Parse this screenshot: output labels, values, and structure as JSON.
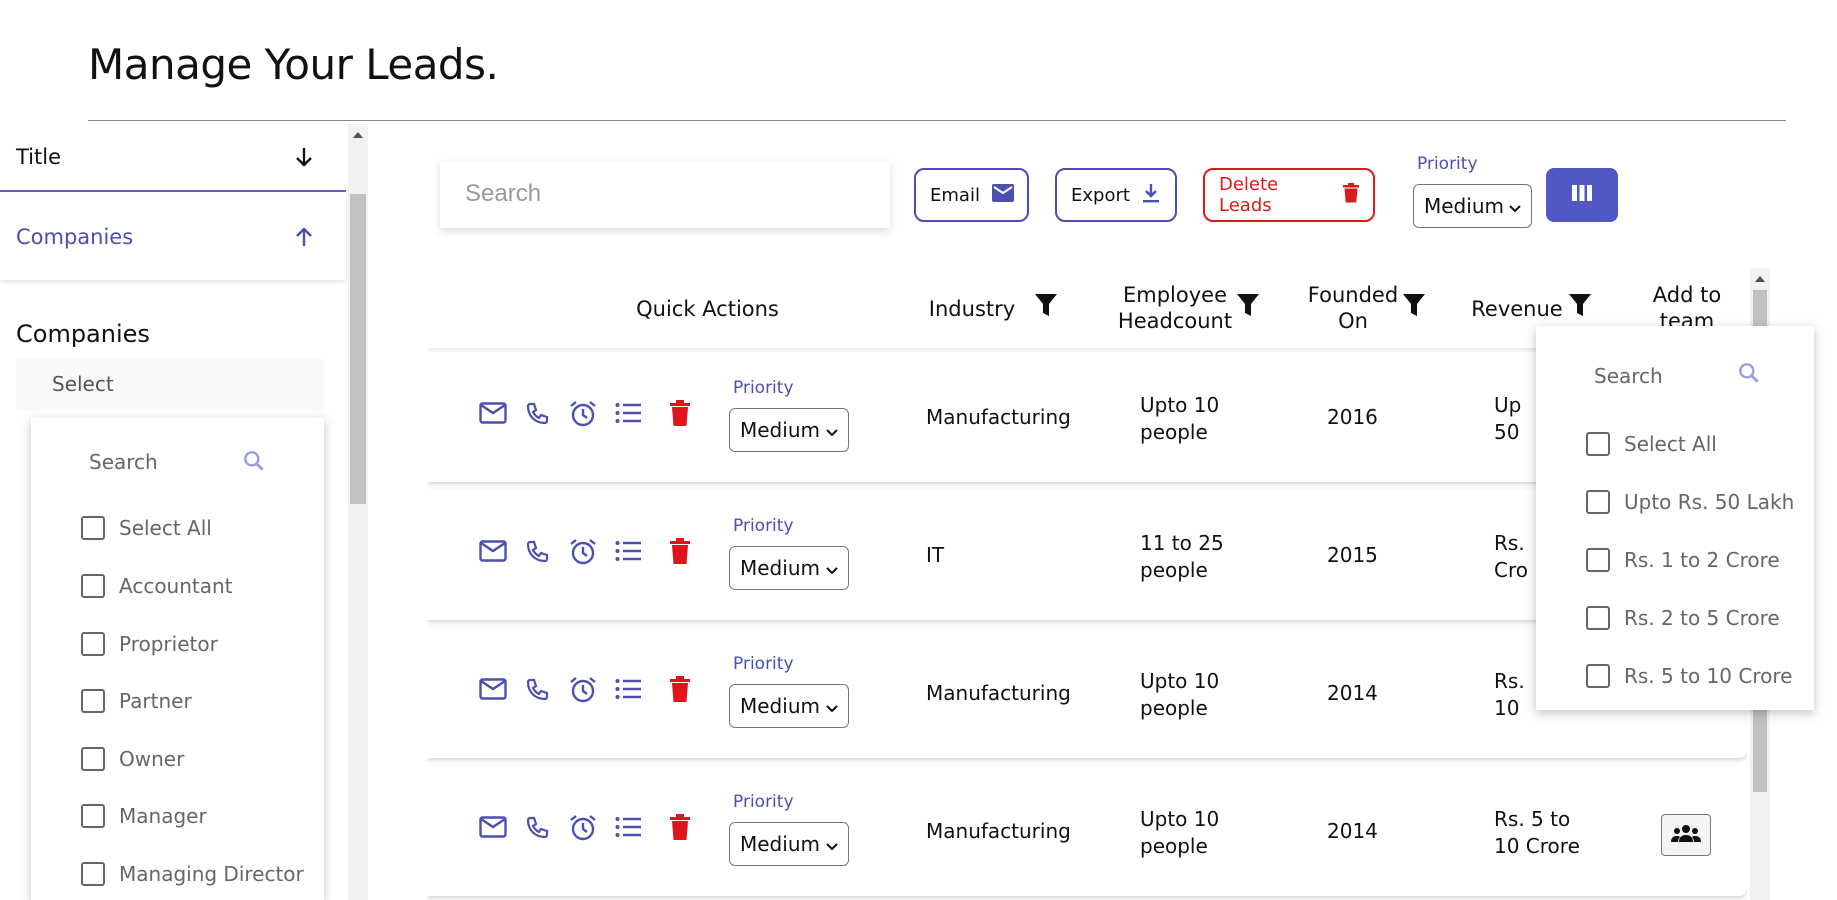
{
  "page": {
    "title": "Manage Your Leads."
  },
  "sidebar": {
    "accordion": [
      {
        "label": "Title"
      },
      {
        "label": "Companies"
      }
    ],
    "section_label": "Companies",
    "select_placeholder": "Select",
    "dropdown": {
      "search_placeholder": "Search",
      "options": [
        "Select All",
        "Accountant",
        "Proprietor",
        "Partner",
        "Owner",
        "Manager",
        "Managing Director"
      ]
    }
  },
  "toolbar": {
    "search_placeholder": "Search",
    "email_label": "Email",
    "export_label": "Export",
    "delete_label": "Delete Leads",
    "priority_label": "Priority",
    "priority_value": "Medium"
  },
  "table": {
    "headers": {
      "quick_actions": "Quick Actions",
      "industry": "Industry",
      "headcount_line1": "Employee",
      "headcount_line2": "Headcount",
      "founded_line1": "Founded",
      "founded_line2": "On",
      "revenue": "Revenue",
      "team_line1": "Add to",
      "team_line2": "team"
    },
    "priority_label": "Priority",
    "rows": [
      {
        "priority": "Medium",
        "industry": "Manufacturing",
        "headcount_line1": "Upto 10",
        "headcount_line2": "people",
        "founded": "2016",
        "revenue_line1": "Up",
        "revenue_line2": "50"
      },
      {
        "priority": "Medium",
        "industry": "IT",
        "headcount_line1": "11 to 25",
        "headcount_line2": "people",
        "founded": "2015",
        "revenue_line1": "Rs.",
        "revenue_line2": "Cro"
      },
      {
        "priority": "Medium",
        "industry": "Manufacturing",
        "headcount_line1": "Upto 10",
        "headcount_line2": "people",
        "founded": "2014",
        "revenue_line1": "Rs.",
        "revenue_line2": "10"
      },
      {
        "priority": "Medium",
        "industry": "Manufacturing",
        "headcount_line1": "Upto 10",
        "headcount_line2": "people",
        "founded": "2014",
        "revenue_line1": "Rs. 5 to",
        "revenue_line2": "10 Crore"
      }
    ]
  },
  "revenue_filter": {
    "search_placeholder": "Search",
    "options": [
      "Select All",
      "Upto Rs. 50 Lakh",
      "Rs. 1 to 2 Crore",
      "Rs. 2 to 5 Crore",
      "Rs. 5 to 10 Crore"
    ]
  },
  "colors": {
    "accent": "#4a4fb0",
    "danger": "#d81b1b",
    "button_fill": "#5257c6"
  },
  "icons": [
    "arrow-down-icon",
    "arrow-up-icon",
    "search-icon",
    "mail-icon",
    "download-icon",
    "trash-icon",
    "columns-icon",
    "filter-icon",
    "phone-icon",
    "alarm-icon",
    "list-icon",
    "team-icon",
    "chevron-down-icon"
  ]
}
